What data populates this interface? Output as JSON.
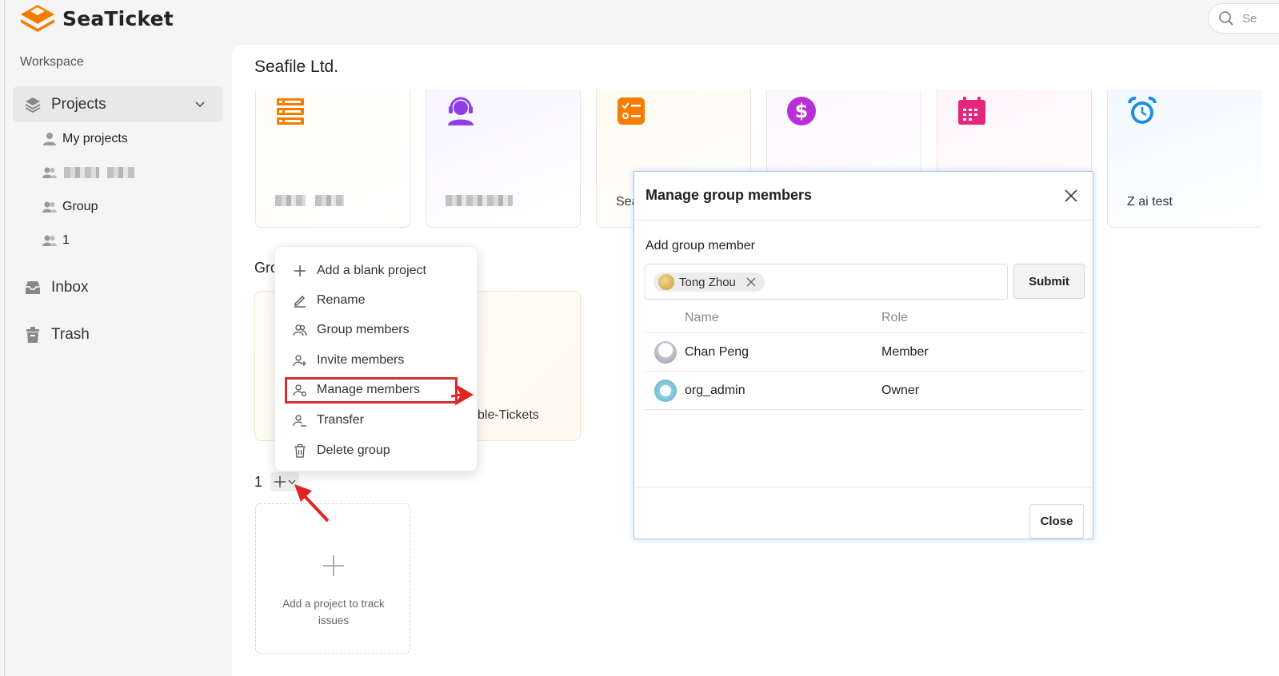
{
  "app": {
    "name": "SeaTicket",
    "search_placeholder": "Se"
  },
  "sidebar": {
    "workspace_label": "Workspace",
    "projects_label": "Projects",
    "sub_items": [
      {
        "label": "My projects"
      },
      {
        "label": ""
      },
      {
        "label": "Group"
      },
      {
        "label": "1"
      }
    ],
    "inbox_label": "Inbox",
    "trash_label": "Trash"
  },
  "main": {
    "title": "Seafile Ltd.",
    "cards": [
      {
        "title": "",
        "icon": "server-list-icon",
        "color": "#f57c00"
      },
      {
        "title": "",
        "icon": "headset-user-icon",
        "color": "#8e3fe8"
      },
      {
        "title": "Sea",
        "icon": "checklist-icon",
        "color": "#f57c00"
      },
      {
        "title": "",
        "icon": "dollar-icon",
        "color": "#b92fd6"
      },
      {
        "title": "",
        "icon": "calendar-icon",
        "color": "#e4267f"
      },
      {
        "title": "Z ai test",
        "icon": "alarm-clock-icon",
        "color": "#1a8fe8"
      }
    ],
    "group_label": "Gro",
    "group_card_title": "ble-Tickets",
    "group2_label": "1",
    "add_project_text": "Add a project to track issues"
  },
  "context_menu": {
    "items": [
      {
        "label": "Add a blank project",
        "icon": "plus-icon"
      },
      {
        "label": "Rename",
        "icon": "pencil-icon"
      },
      {
        "label": "Group members",
        "icon": "users-icon"
      },
      {
        "label": "Invite members",
        "icon": "user-plus-icon"
      },
      {
        "label": "Manage members",
        "icon": "user-gear-icon"
      },
      {
        "label": "Transfer",
        "icon": "user-transfer-icon"
      },
      {
        "label": "Delete group",
        "icon": "trash-icon"
      }
    ]
  },
  "dialog": {
    "title": "Manage group members",
    "add_label": "Add group member",
    "selected_member": "Tong Zhou",
    "submit_label": "Submit",
    "columns": {
      "name": "Name",
      "role": "Role"
    },
    "members": [
      {
        "name": "Chan Peng",
        "role": "Member"
      },
      {
        "name": "org_admin",
        "role": "Owner"
      }
    ],
    "close_label": "Close"
  },
  "colors": {
    "brand": "#f57c00",
    "annotation_red": "#d32f2f"
  }
}
